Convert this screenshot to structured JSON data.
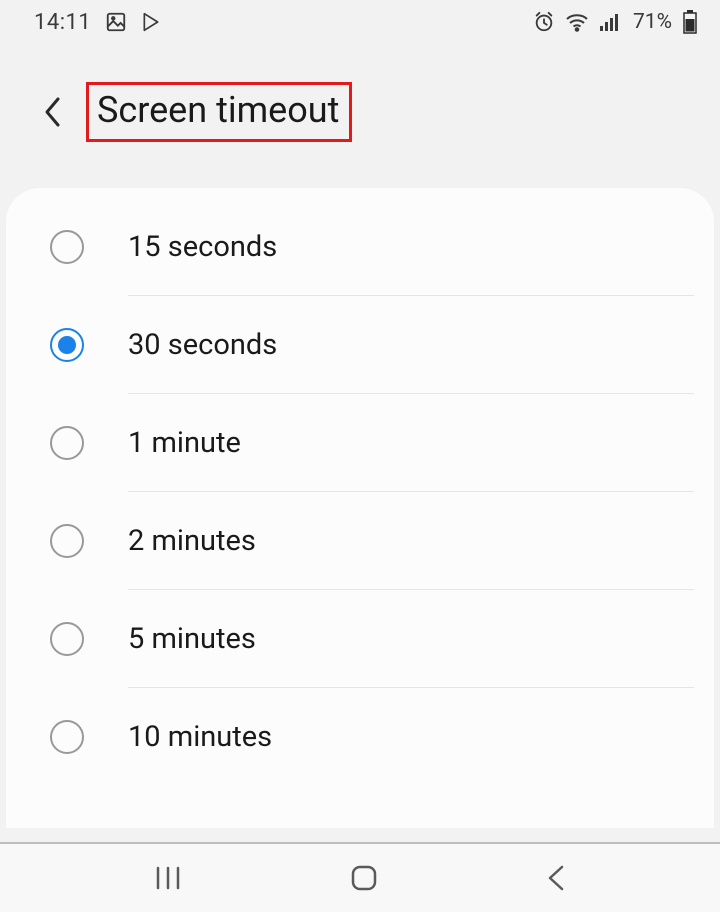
{
  "statusbar": {
    "time": "14:11",
    "battery_text": "71%"
  },
  "header": {
    "title": "Screen timeout"
  },
  "options": [
    {
      "label": "15 seconds",
      "selected": false
    },
    {
      "label": "30 seconds",
      "selected": true
    },
    {
      "label": "1 minute",
      "selected": false
    },
    {
      "label": "2 minutes",
      "selected": false
    },
    {
      "label": "5 minutes",
      "selected": false
    },
    {
      "label": "10 minutes",
      "selected": false
    }
  ]
}
